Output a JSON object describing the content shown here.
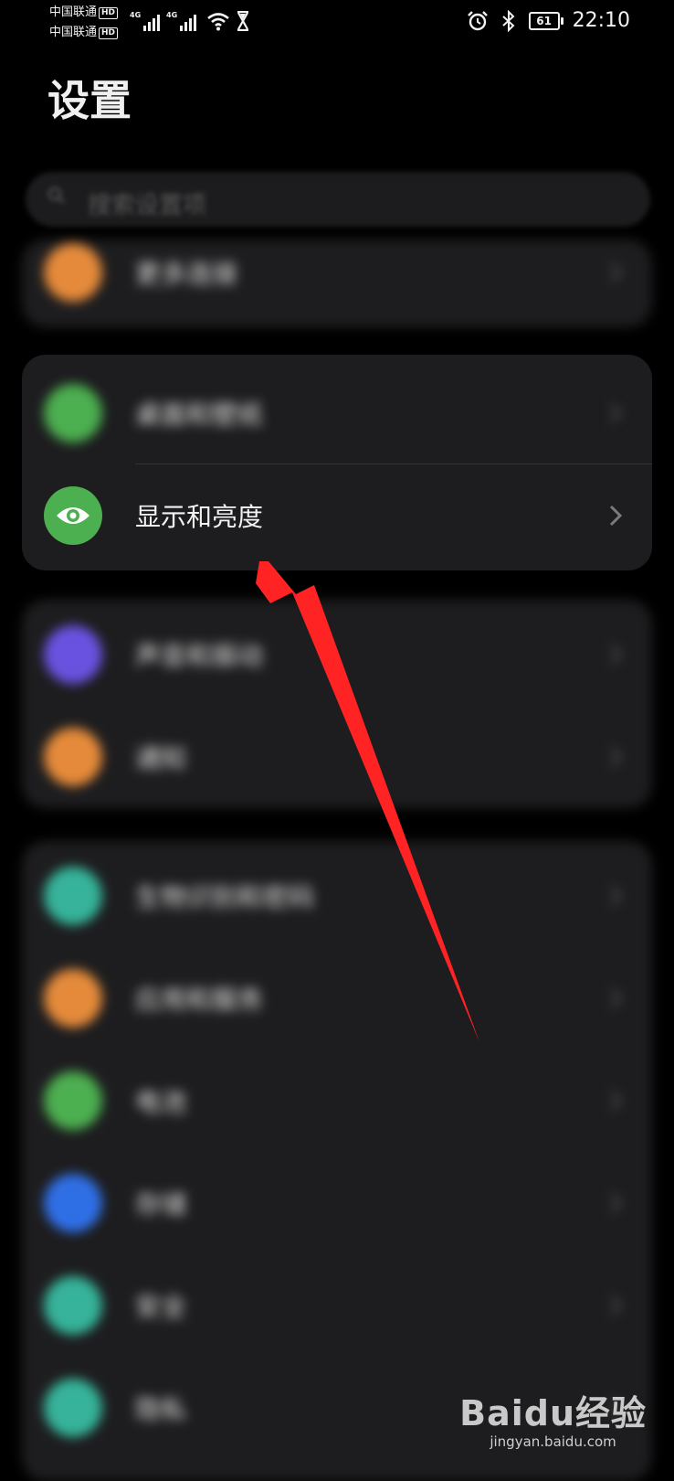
{
  "status_bar": {
    "carrier1": "中国联通",
    "carrier2": "中国联通",
    "hd": "HD",
    "net1": "4G",
    "net2": "4G",
    "battery": "61",
    "time": "22:10"
  },
  "page": {
    "title": "设置"
  },
  "search": {
    "placeholder": "搜索设置项"
  },
  "items": [
    {
      "label": "更多连接",
      "color": "#e58a3a"
    },
    {
      "label": "桌面和壁纸",
      "color": "#4caf50"
    },
    {
      "label": "显示和亮度",
      "color": "#4caf50"
    },
    {
      "label": "声音和振动",
      "color": "#6a52e0"
    },
    {
      "label": "通知",
      "color": "#e58a3a"
    },
    {
      "label": "生物识别和密码",
      "color": "#36b39a"
    },
    {
      "label": "应用和服务",
      "color": "#e58a3a"
    },
    {
      "label": "电池",
      "color": "#4caf50"
    },
    {
      "label": "存储",
      "color": "#2f6fe6"
    },
    {
      "label": "安全",
      "color": "#36b39a"
    },
    {
      "label": "隐私",
      "color": "#36b39a"
    }
  ],
  "watermark": {
    "logo": "Baidu经验",
    "url": "jingyan.baidu.com"
  }
}
